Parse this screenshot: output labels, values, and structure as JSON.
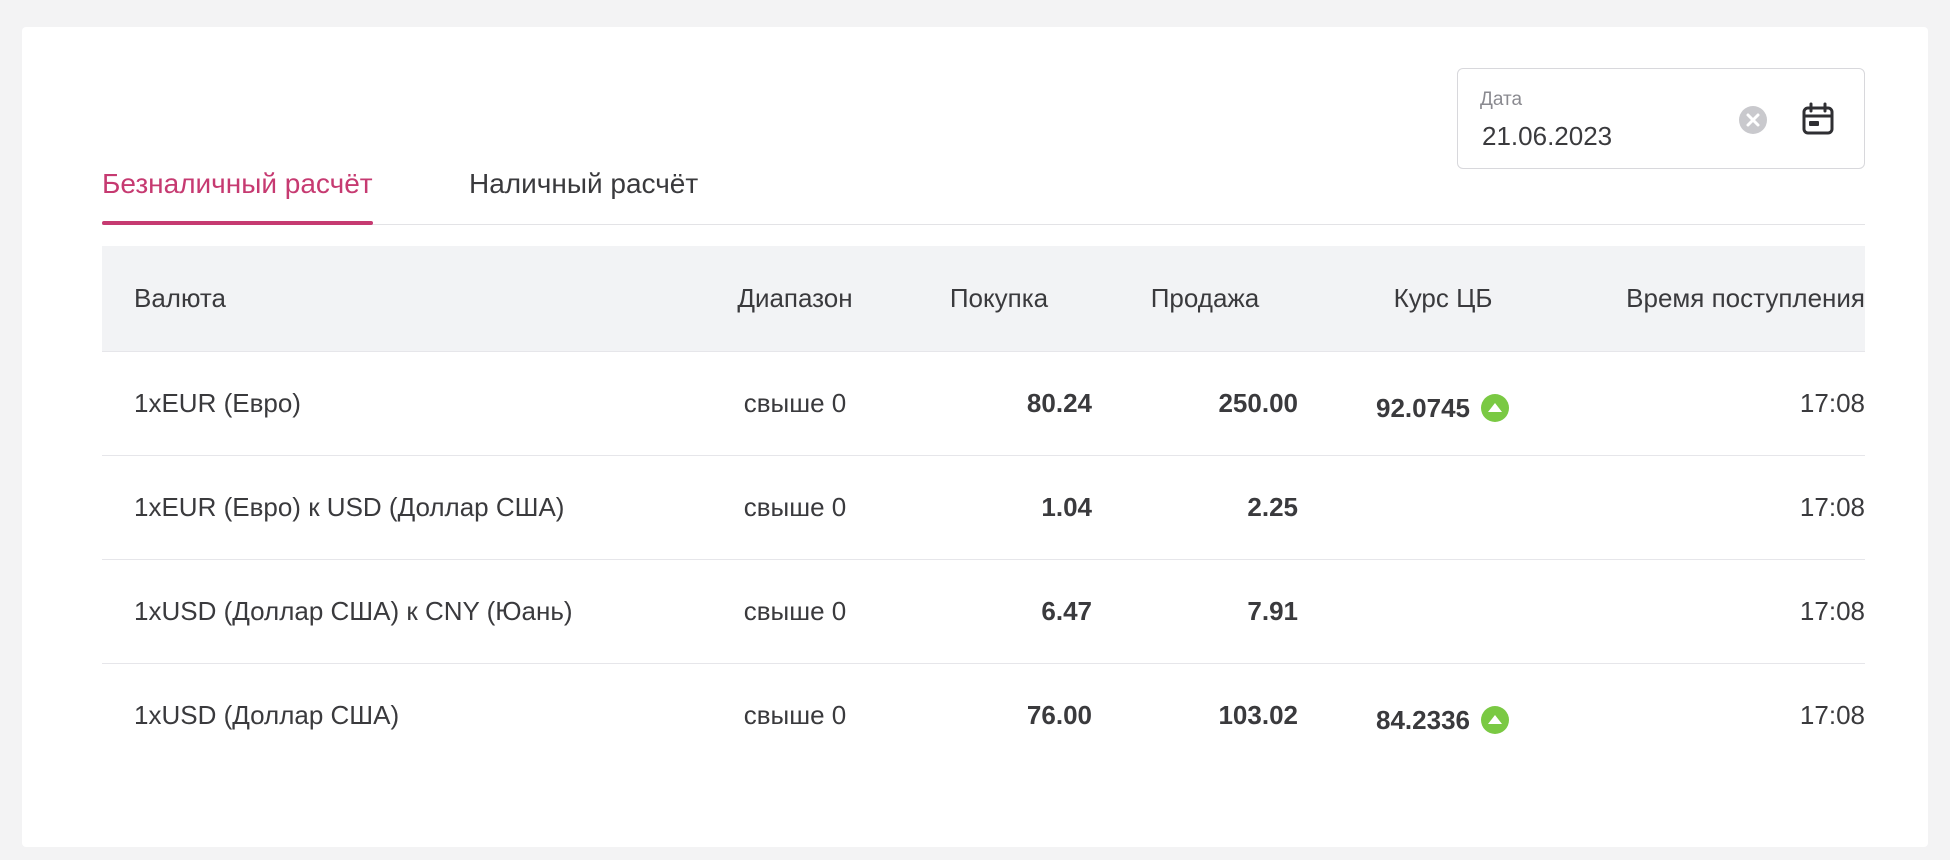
{
  "tabs": [
    {
      "label": "Безналичный расчёт",
      "active": true
    },
    {
      "label": "Наличный расчёт",
      "active": false
    }
  ],
  "date_field": {
    "label": "Дата",
    "value": "21.06.2023",
    "clear_icon": "clear-circle-icon",
    "calendar_icon": "calendar-icon"
  },
  "table": {
    "headers": [
      "Валюта",
      "Диапазон",
      "Покупка",
      "Продажа",
      "Курс ЦБ",
      "Время поступления"
    ],
    "rows": [
      {
        "currency": "1xEUR (Евро)",
        "range": "свыше 0",
        "buy": "80.24",
        "sell": "250.00",
        "cb_rate": "92.0745",
        "cb_trend": "up",
        "time": "17:08"
      },
      {
        "currency": "1xEUR (Евро) к USD (Доллар США)",
        "range": "свыше 0",
        "buy": "1.04",
        "sell": "2.25",
        "cb_rate": "",
        "cb_trend": "",
        "time": "17:08"
      },
      {
        "currency": "1xUSD (Доллар США) к CNY (Юань)",
        "range": "свыше 0",
        "buy": "6.47",
        "sell": "7.91",
        "cb_rate": "",
        "cb_trend": "",
        "time": "17:08"
      },
      {
        "currency": "1xUSD (Доллар США)",
        "range": "свыше 0",
        "buy": "76.00",
        "sell": "103.02",
        "cb_rate": "84.2336",
        "cb_trend": "up",
        "time": "17:08"
      }
    ]
  },
  "colors": {
    "accent": "#c63a71",
    "trend_up": "#7ac943",
    "header_bg": "#f2f3f5"
  }
}
